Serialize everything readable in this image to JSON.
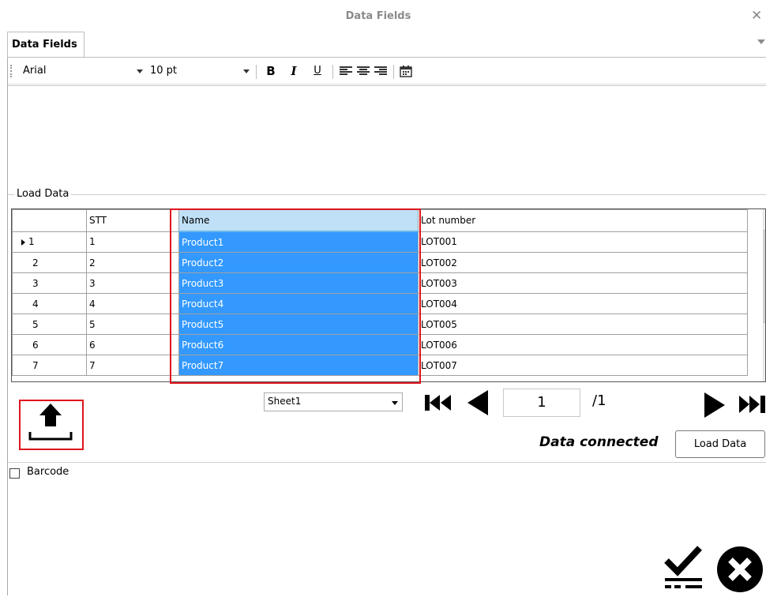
{
  "window": {
    "title": "Data Fields"
  },
  "tabs": [
    {
      "label": "Data Fields"
    }
  ],
  "toolbar": {
    "font_name": "Arial",
    "font_size": "10 pt",
    "bold": "B",
    "italic": "I",
    "underline": "U"
  },
  "load_data": {
    "legend": "Load Data",
    "columns": [
      "STT",
      "Name",
      "Lot number"
    ],
    "rows": [
      {
        "num": "1",
        "stt": "1",
        "name": "Product1",
        "lot": "LOT001"
      },
      {
        "num": "2",
        "stt": "2",
        "name": "Product2",
        "lot": "LOT002"
      },
      {
        "num": "3",
        "stt": "3",
        "name": "Product3",
        "lot": "LOT003"
      },
      {
        "num": "4",
        "stt": "4",
        "name": "Product4",
        "lot": "LOT004"
      },
      {
        "num": "5",
        "stt": "5",
        "name": "Product5",
        "lot": "LOT005"
      },
      {
        "num": "6",
        "stt": "6",
        "name": "Product6",
        "lot": "LOT006"
      },
      {
        "num": "7",
        "stt": "7",
        "name": "Product7",
        "lot": "LOT007"
      }
    ],
    "sheet": "Sheet1",
    "page_current": "1",
    "page_total": "/1",
    "status": "Data connected",
    "load_button": "Load Data"
  },
  "barcode": {
    "label": "Barcode",
    "checked": false
  },
  "colors": {
    "selection": "#3399ff",
    "highlight_box": "#e0141e"
  }
}
